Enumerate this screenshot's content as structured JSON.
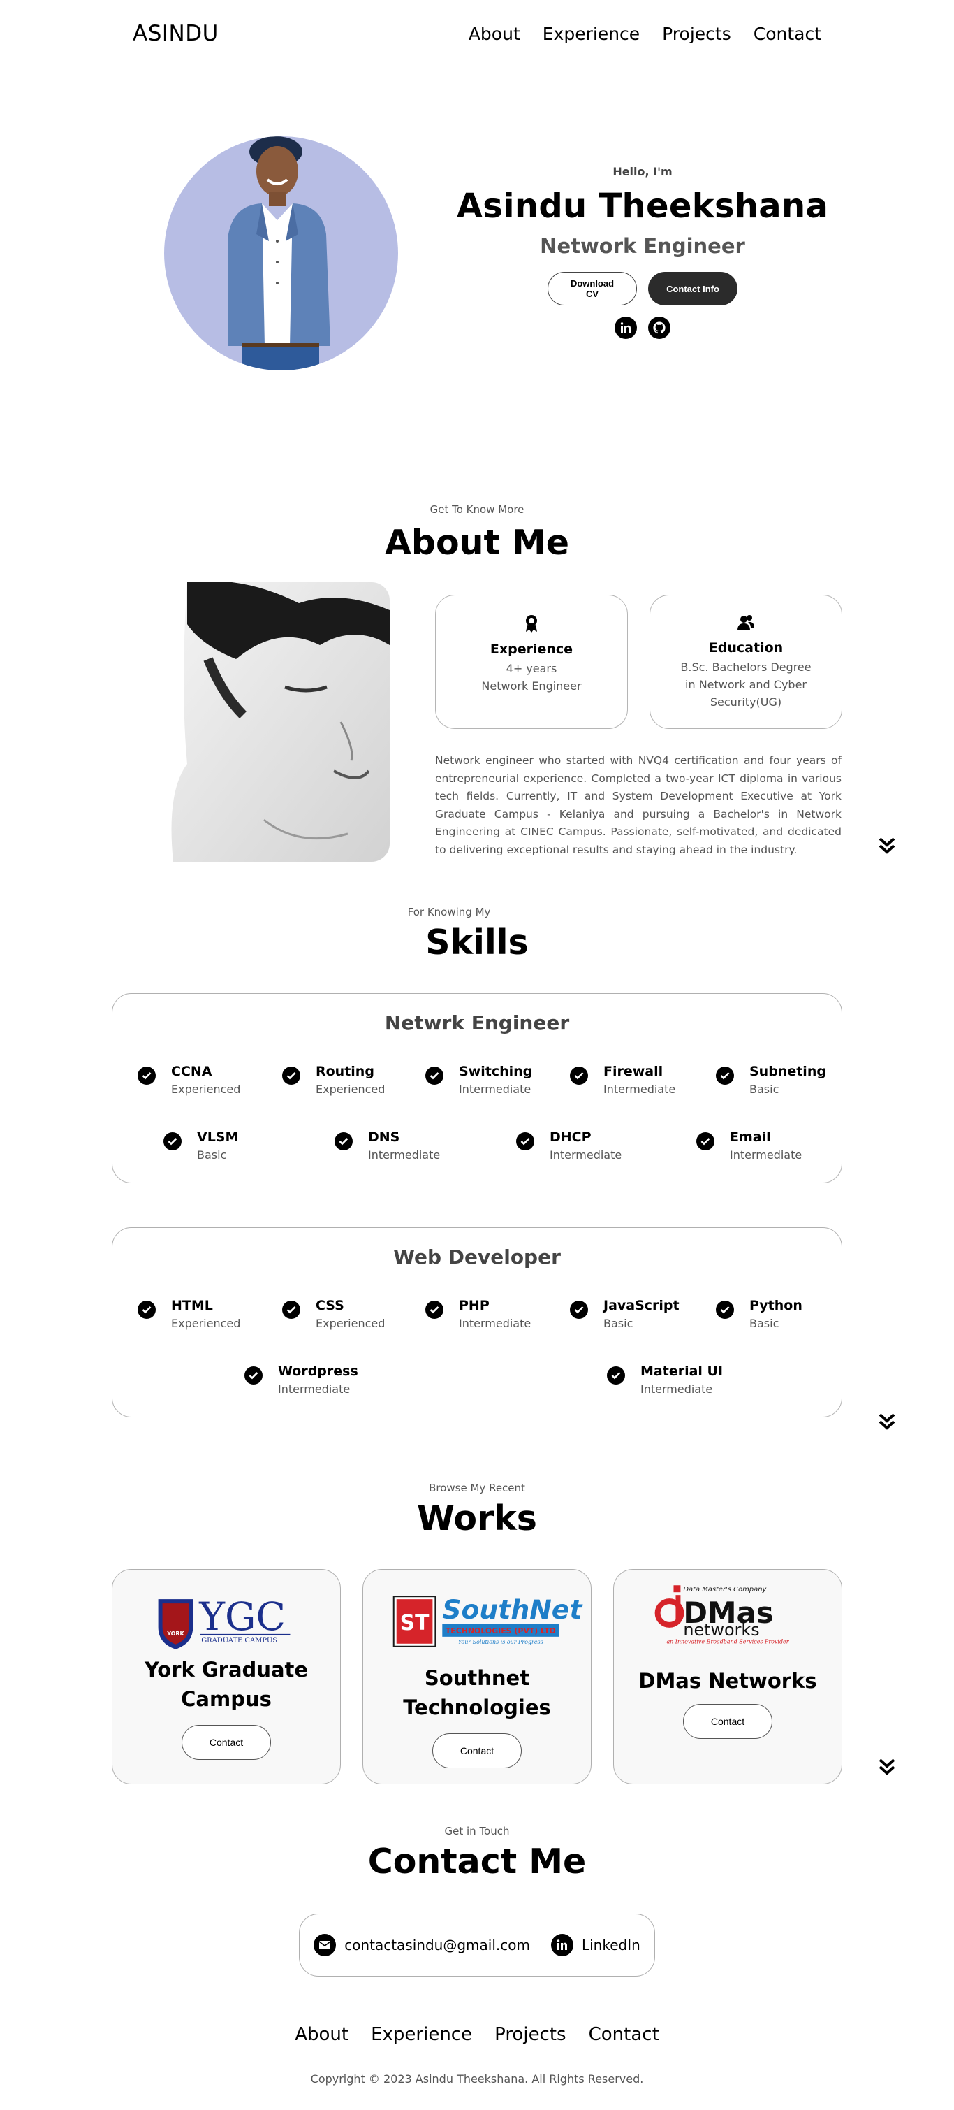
{
  "nav": {
    "logo": "ASINDU",
    "links": [
      "About",
      "Experience",
      "Projects",
      "Contact"
    ]
  },
  "hero": {
    "greeting": "Hello, I'm",
    "name": "Asindu Theekshana",
    "role": "Network Engineer",
    "download_cv": "Download CV",
    "contact_info": "Contact Info",
    "social_icons": [
      "linkedin-icon",
      "github-icon"
    ]
  },
  "about": {
    "kicker": "Get To Know More",
    "heading": "About Me",
    "experience": {
      "icon": "award-icon",
      "title": "Experience",
      "lines": [
        "4+ years",
        "Network Engineer"
      ]
    },
    "education": {
      "icon": "users-icon",
      "title": "Education",
      "lines": [
        "B.Sc. Bachelors Degree",
        "in Network and Cyber",
        "Security(UG)"
      ]
    },
    "paragraph": "Network engineer who started with NVQ4 certification and four years of entrepreneurial experience. Completed a two-year ICT diploma in various tech fields. Currently, IT and System Development Executive at York Graduate Campus - Kelaniya and pursuing a Bachelor's in Network Engineering at CINEC Campus. Passionate, self-motivated, and dedicated to delivering exceptional results and staying ahead in the industry."
  },
  "skills": {
    "kicker": "For Knowing My",
    "heading": "Skills",
    "network": {
      "title": "Netwrk Engineer",
      "items": [
        {
          "name": "CCNA",
          "level": "Experienced"
        },
        {
          "name": "Routing",
          "level": "Experienced"
        },
        {
          "name": "Switching",
          "level": "Intermediate"
        },
        {
          "name": "Firewall",
          "level": "Intermediate"
        },
        {
          "name": "Subneting",
          "level": "Basic"
        },
        {
          "name": "VLSM",
          "level": "Basic"
        },
        {
          "name": "DNS",
          "level": "Intermediate"
        },
        {
          "name": "DHCP",
          "level": "Intermediate"
        },
        {
          "name": "Email",
          "level": "Intermediate"
        }
      ]
    },
    "web": {
      "title": "Web Developer",
      "items": [
        {
          "name": "HTML",
          "level": "Experienced"
        },
        {
          "name": "CSS",
          "level": "Experienced"
        },
        {
          "name": "PHP",
          "level": "Intermediate"
        },
        {
          "name": "JavaScript",
          "level": "Basic"
        },
        {
          "name": "Python",
          "level": "Basic"
        },
        {
          "name": "Wordpress",
          "level": "Intermediate"
        },
        {
          "name": "Material UI",
          "level": "Intermediate"
        }
      ]
    }
  },
  "works": {
    "kicker": "Browse My Recent",
    "heading": "Works",
    "projects": [
      {
        "name_lines": [
          "York Graduate",
          "Campus"
        ],
        "button": "Contact",
        "logo": {
          "main": "YGC",
          "sub": "GRADUATE CAMPUS",
          "badge": "YORK"
        }
      },
      {
        "name_lines": [
          "Southnet",
          "Technologies"
        ],
        "button": "Contact",
        "logo": {
          "main": "SouthNet",
          "mark": "ST",
          "sub": "TECHNOLOGIES (PVT) LTD",
          "tagline": "Your Solutions is our Progress"
        }
      },
      {
        "name_lines": [
          "DMas Networks"
        ],
        "button": "Contact",
        "logo": {
          "top": "Data Master's Company",
          "main": "DMas",
          "sub": "networks",
          "tagline": "an Innovative Broadband Services Provider"
        }
      }
    ]
  },
  "contact": {
    "kicker": "Get in Touch",
    "heading": "Contact Me",
    "email": "contactasindu@gmail.com",
    "linkedin": "LinkedIn"
  },
  "footer": {
    "links": [
      "About",
      "Experience",
      "Projects",
      "Contact"
    ],
    "copyright": "Copyright © 2023 Asindu Theekshana. All Rights Reserved."
  },
  "colors": {
    "hero_circle": "#b7bde4",
    "dark_button": "#2b2b2b",
    "card_border": "#b0b0b0",
    "muted_text": "#555555"
  }
}
